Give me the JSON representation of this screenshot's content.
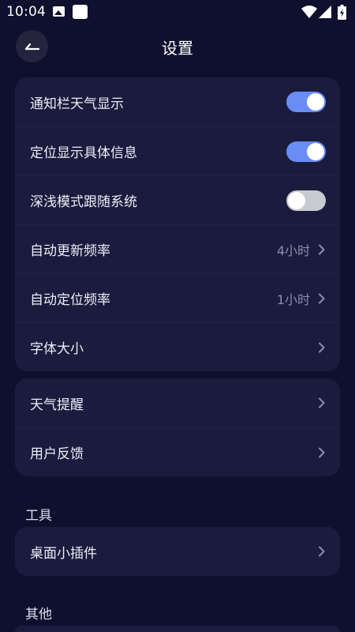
{
  "status_bar": {
    "time": "10:04",
    "icons": [
      "image-icon",
      "square-notification-icon",
      "wifi-icon",
      "signal-icon",
      "battery-icon"
    ]
  },
  "header": {
    "title": "设置",
    "back_icon": "back-arrow-icon"
  },
  "card1": {
    "rows": [
      {
        "label": "通知栏天气显示",
        "toggle": true
      },
      {
        "label": "定位显示具体信息",
        "toggle": true
      },
      {
        "label": "深浅模式跟随系统",
        "toggle": false
      },
      {
        "label": "自动更新频率",
        "value": "4小时"
      },
      {
        "label": "自动定位频率",
        "value": "1小时"
      },
      {
        "label": "字体大小"
      }
    ]
  },
  "card2": {
    "rows": [
      {
        "label": "天气提醒"
      },
      {
        "label": "用户反馈"
      }
    ]
  },
  "tools": {
    "section_title": "工具",
    "rows": [
      {
        "label": "桌面小插件"
      }
    ]
  },
  "others": {
    "section_title": "其他"
  },
  "colors": {
    "background": "#0f0f2e",
    "card": "#1b1b3e",
    "toggle_on": "#6a8df5",
    "toggle_off": "#c9c9d2"
  }
}
